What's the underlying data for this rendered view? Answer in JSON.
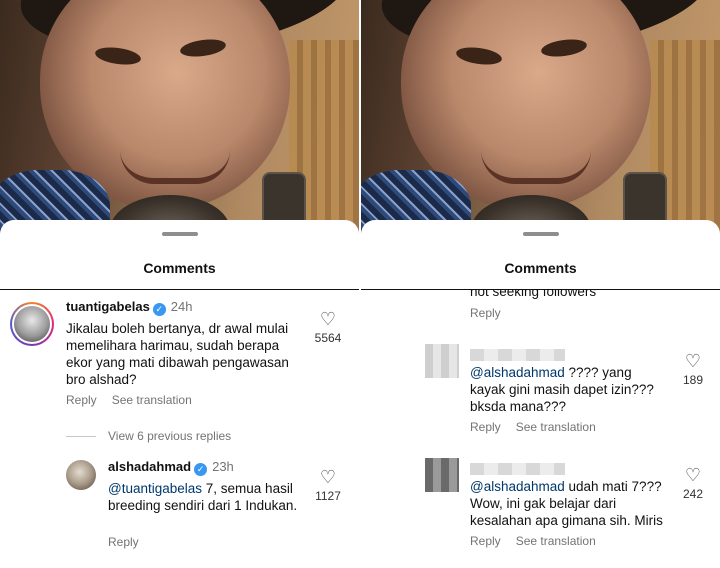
{
  "sheet_title": "Comments",
  "left": {
    "comments": [
      {
        "username": "tuantigabelas",
        "time": "24h",
        "text": "Jikalau boleh bertanya, dr awal mulai memelihara harimau, sudah berapa ekor yang mati dibawah pengawasan bro alshad?",
        "reply_label": "Reply",
        "translate_label": "See translation",
        "likes": "5564"
      }
    ],
    "view_replies": "View 6 previous replies",
    "reply": {
      "username": "alshadahmad",
      "time": "23h",
      "mention": "@tuantigabelas",
      "text": " 7, semua hasil breeding sendiri dari 1 Indukan.",
      "reply_label": "Reply",
      "likes": "1127"
    }
  },
  "right": {
    "partial_text": "not seeking followers",
    "partial_reply_label": "Reply",
    "comments": [
      {
        "mention": "@alshadahmad",
        "text": " ???? yang kayak gini masih dapet izin??? bksda mana???",
        "reply_label": "Reply",
        "translate_label": "See translation",
        "likes": "189"
      },
      {
        "mention": "@alshadahmad",
        "text": " udah mati 7??? Wow, ini gak belajar dari kesalahan apa gimana sih. Miris",
        "reply_label": "Reply",
        "translate_label": "See translation",
        "likes": "242"
      }
    ]
  },
  "icons": {
    "verified": "verified-badge-icon",
    "like": "heart-outline-icon"
  },
  "colors": {
    "verified": "#3897f0",
    "mention": "#00376b",
    "meta": "#737373"
  }
}
